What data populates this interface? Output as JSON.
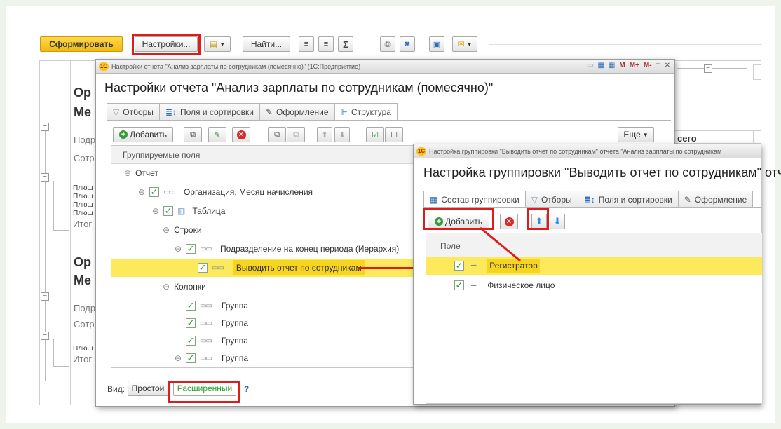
{
  "toolbar": {
    "form_label": "Сформировать",
    "settings_label": "Настройки...",
    "find_label": "Найти...",
    "sum_symbol": "Σ"
  },
  "background": {
    "org_label_1": "Ор",
    "month_label_1": "Ме",
    "podr_label_1": "Подр",
    "sotr_label_1": "Сотр",
    "plush_rows_1": [
      "Плюш",
      "Плюш",
      "Плюш",
      "Плюш"
    ],
    "itog_label_1": "Итог",
    "org_label_2": "Ор",
    "month_label_2": "Ме",
    "podr_label_2": "Подр",
    "sotr_label_2": "Сотр",
    "plush_rows_2": [
      "Плюш"
    ],
    "itog_label_2": "Итог",
    "vsego_label": "сего"
  },
  "settings_window": {
    "titlebar_text": "Настройки отчета \"Анализ зарплаты по сотрудникам (помесячно)\" (1С:Предприятие)",
    "title": "Настройки отчета \"Анализ зарплаты по сотрудникам (помесячно)\"",
    "win_buttons": [
      "M",
      "M+",
      "M-",
      "□",
      "✕"
    ],
    "tabs": [
      "Отборы",
      "Поля и сортировки",
      "Оформление",
      "Структура"
    ],
    "add_label": "Добавить",
    "more_label": "Еще",
    "column_header": "Группируемые поля",
    "tree": {
      "report": "Отчет",
      "org_month": "Организация, Месяц начисления",
      "table": "Таблица",
      "rows": "Строки",
      "subdivision": "Подразделение на конец периода (Иерархия)",
      "by_employee": "Выводить отчет по сотрудникам",
      "columns": "Колонки",
      "group_1": "Группа",
      "group_2": "Группа",
      "group_3": "Группа",
      "group_4": "Группа"
    },
    "view_label": "Вид:",
    "simple_label": "Простой",
    "advanced_label": "Расширенный",
    "help_label": "?"
  },
  "grouping_window": {
    "titlebar_text": "Настройка группировки \"Выводить отчет по сотрудникам\" отчета \"Анализ зарплаты по сотрудникам",
    "title": "Настройка группировки \"Выводить отчет по сотрудникам\" отч",
    "tabs": [
      "Состав группировки",
      "Отборы",
      "Поля и сортировки",
      "Оформление"
    ],
    "add_label": "Добавить",
    "column_header": "Поле",
    "fields": [
      "Регистратор",
      "Физическое лицо"
    ]
  },
  "colors": {
    "accent_yellow": "#fce95c",
    "highlight_red": "#e01b1b",
    "check_green": "#2e9a2e",
    "form_button": "#f2c21a"
  }
}
